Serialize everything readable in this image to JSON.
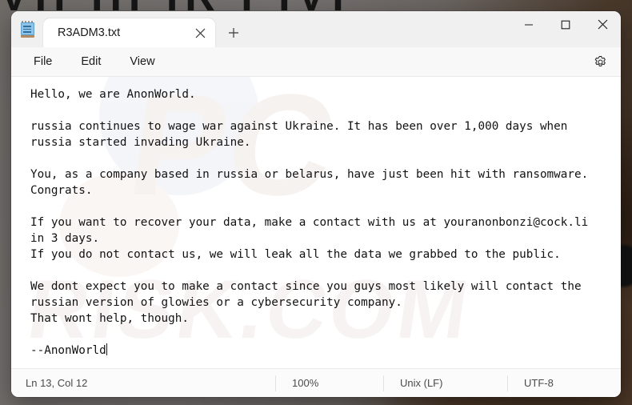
{
  "desktop": {
    "backdrop_letters": "VII III IR I IVI",
    "background_color": "#6e6a66"
  },
  "window": {
    "app_icon": "notepad-icon",
    "tab": {
      "title": "R3ADM3.txt",
      "close_icon": "close-icon",
      "new_tab_icon": "plus-icon"
    },
    "caption": {
      "minimize_icon": "minimize-icon",
      "maximize_icon": "maximize-icon",
      "close_icon": "close-icon"
    }
  },
  "menubar": {
    "items": [
      {
        "label": "File"
      },
      {
        "label": "Edit"
      },
      {
        "label": "View"
      }
    ],
    "settings_icon": "gear-icon"
  },
  "editor": {
    "watermark_big": "PC",
    "watermark_small": "RISK.COM",
    "content": "Hello, we are AnonWorld.\n\nrussia continues to wage war against Ukraine. It has been over 1,000 days when\nrussia started invading Ukraine.\n\nYou, as a company based in russia or belarus, have just been hit with ransomware.\nCongrats.\n\nIf you want to recover your data, make a contact with us at youranonbonzi@cock.li\nin 3 days.\nIf you do not contact us, we will leak all the data we grabbed to the public.\n\nWe dont expect you to make a contact since you guys most likely will contact the\nrussian version of glowies or a cybersecurity company.\nThat wont help, though.\n\n--AnonWorld"
  },
  "statusbar": {
    "position": "Ln 13, Col 12",
    "zoom": "100%",
    "line_ending": "Unix (LF)",
    "encoding": "UTF-8"
  }
}
